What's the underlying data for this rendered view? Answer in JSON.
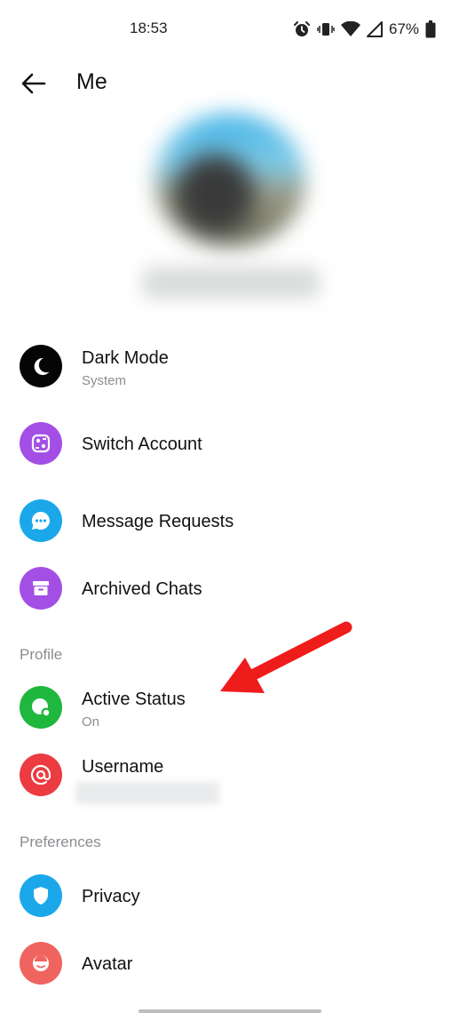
{
  "status_bar": {
    "time": "18:53",
    "battery_percent": "67%",
    "icons": [
      "alarm-icon",
      "vibrate-icon",
      "wifi-icon",
      "signal-icon",
      "battery-icon"
    ]
  },
  "header": {
    "title": "Me",
    "back_icon": "back-arrow-icon"
  },
  "menu": {
    "dark_mode": {
      "label": "Dark Mode",
      "sub": "System",
      "icon": "moon-icon",
      "color": "#050505"
    },
    "switch_account": {
      "label": "Switch Account",
      "icon": "switch-account-icon",
      "color": "#a34fe5"
    },
    "message_requests": {
      "label": "Message Requests",
      "icon": "chat-bubble-icon",
      "color": "#1aa8ea"
    },
    "archived_chats": {
      "label": "Archived Chats",
      "icon": "archive-box-icon",
      "color": "#a34fe5"
    }
  },
  "profile_section": {
    "title": "Profile",
    "active_status": {
      "label": "Active Status",
      "sub": "On",
      "icon": "active-status-icon",
      "color": "#1fb73e"
    },
    "username": {
      "label": "Username",
      "icon": "at-sign-icon",
      "color": "#ec3b41"
    }
  },
  "preferences_section": {
    "title": "Preferences",
    "privacy": {
      "label": "Privacy",
      "icon": "shield-icon",
      "color": "#1aa8ea"
    },
    "avatar": {
      "label": "Avatar",
      "icon": "avatar-face-icon",
      "color": "#f0645f"
    }
  },
  "annotation": {
    "arrow_color": "#ef1c1c"
  }
}
